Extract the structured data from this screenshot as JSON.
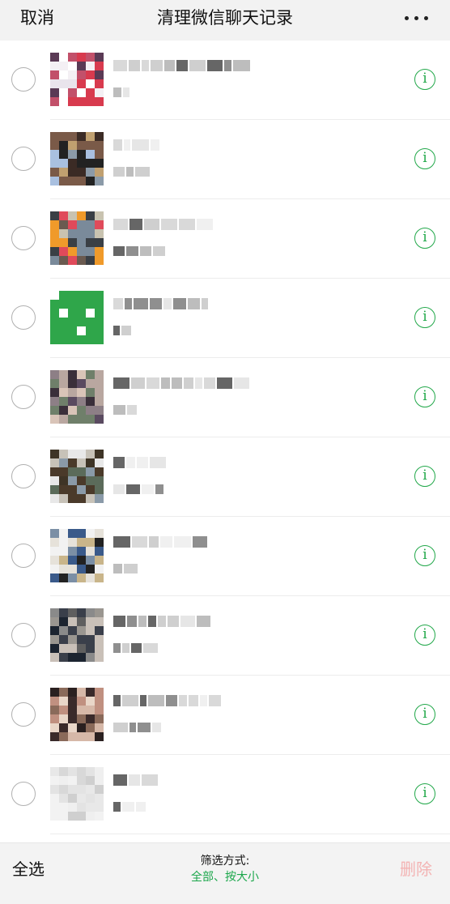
{
  "header": {
    "cancel_label": "取消",
    "title": "清理微信聊天记录",
    "more_label": "···"
  },
  "rows": [
    {
      "info": "i"
    },
    {
      "info": "i"
    },
    {
      "info": "i"
    },
    {
      "info": "i"
    },
    {
      "info": "i"
    },
    {
      "info": "i"
    },
    {
      "info": "i"
    },
    {
      "info": "i"
    },
    {
      "info": "i"
    },
    {
      "info": "i"
    }
  ],
  "footer": {
    "select_all_label": "全选",
    "filter_label": "筛选方式:",
    "filter_value": "全部、按大小",
    "delete_label": "删除"
  },
  "colors": {
    "accent_green": "#22a84a",
    "delete_disabled": "#f3b3b3"
  }
}
